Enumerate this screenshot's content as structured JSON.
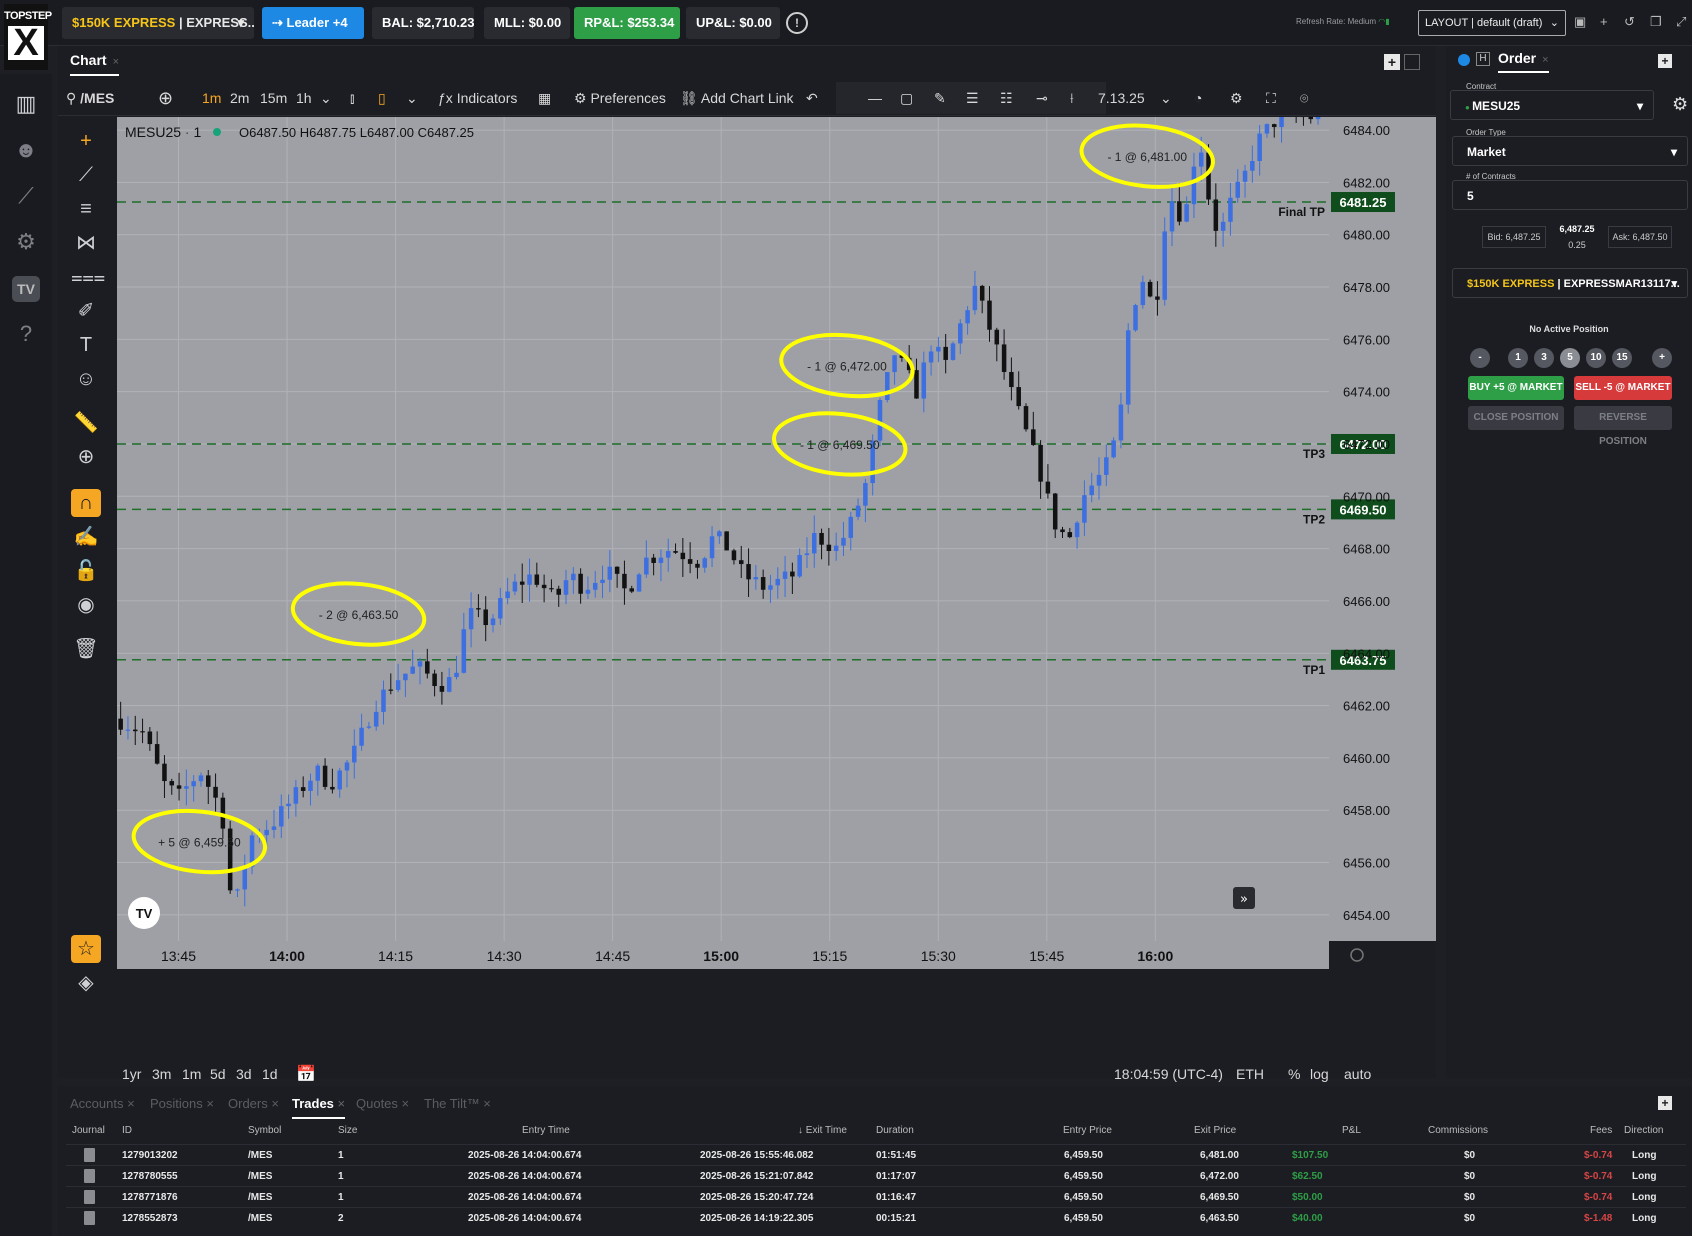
{
  "logo": {
    "line1": "TOPSTEP",
    "line2": "X"
  },
  "topbar": {
    "account_prefix": "$150K EXPRESS",
    "account_suffix": " | EXPRESS...",
    "leader_label": "Leader +4",
    "bal": "BAL: $2,710.23",
    "mll": "MLL: $0.00",
    "rpl": "RP&L: $253.34",
    "upl": "UP&L: $0.00",
    "refresh_label": "Refresh Rate: Medium",
    "layout_label": "LAYOUT | default (draft)"
  },
  "chart_panel": {
    "tab_label": "Chart",
    "symbol_search": "/MES",
    "timeframes": [
      "1m",
      "2m",
      "15m",
      "1h"
    ],
    "active_timeframe": "1m",
    "indicators_label": "Indicators",
    "preferences_label": "Preferences",
    "add_chart_link_label": "Add Chart Link",
    "version_label": "7.13.25",
    "bottom_ranges": [
      "1yr",
      "3m",
      "1m",
      "5d",
      "3d",
      "1d"
    ],
    "clock": "18:04:59 (UTC-4)",
    "session": "ETH",
    "scale_options": [
      "%",
      "log",
      "auto"
    ]
  },
  "chart_data": {
    "type": "candlestick",
    "symbol": "MESU25",
    "interval": "1",
    "ohlc_readout": {
      "open": "O6487.50",
      "high": "H6487.75",
      "low": "L6487.00",
      "close": "C6487.25"
    },
    "colors": {
      "up": "#3d6fe0",
      "down": "#121212",
      "background": "#9ea0a6",
      "tp_line": "#1f6e2a",
      "annotation": "#ffff00"
    },
    "ylim": [
      6453.0,
      6484.5
    ],
    "y_ticks": [
      "6484.00",
      "6482.00",
      "6480.00",
      "6478.00",
      "6476.00",
      "6474.00",
      "6472.00",
      "6470.00",
      "6468.00",
      "6466.00",
      "6464.00",
      "6462.00",
      "6460.00",
      "6458.00",
      "6456.00",
      "6454.00"
    ],
    "x_ticks": [
      {
        "label": "13:45",
        "minute": 0,
        "bold": false
      },
      {
        "label": "14:00",
        "minute": 15,
        "bold": true
      },
      {
        "label": "14:15",
        "minute": 30,
        "bold": false
      },
      {
        "label": "14:30",
        "minute": 45,
        "bold": false
      },
      {
        "label": "14:45",
        "minute": 60,
        "bold": false
      },
      {
        "label": "15:00",
        "minute": 75,
        "bold": true
      },
      {
        "label": "15:15",
        "minute": 90,
        "bold": false
      },
      {
        "label": "15:30",
        "minute": 105,
        "bold": false
      },
      {
        "label": "15:45",
        "minute": 120,
        "bold": false
      },
      {
        "label": "16:00",
        "minute": 135,
        "bold": true
      }
    ],
    "x_range_minutes": [
      -8.5,
      159
    ],
    "levels": [
      {
        "name": "Final TP",
        "price": 6481.25,
        "label": "6481.25"
      },
      {
        "name": "TP3",
        "price": 6472.0,
        "label": "6472.00"
      },
      {
        "name": "TP2",
        "price": 6469.5,
        "label": "6469.50"
      },
      {
        "name": "TP1",
        "price": 6463.75,
        "label": "6463.75"
      }
    ],
    "annotations": [
      {
        "text": "+ 5 @ 6,459.50",
        "minute": 1.5,
        "price": 6456.8
      },
      {
        "text": "- 2 @ 6,463.50",
        "minute": 23.5,
        "price": 6465.5
      },
      {
        "text": "- 1 @ 6,469.50",
        "minute": 90,
        "price": 6472.0
      },
      {
        "text": "- 1 @ 6,472.00",
        "minute": 91,
        "price": 6475.0
      },
      {
        "text": "- 1 @ 6,481.00",
        "minute": 132.5,
        "price": 6483.0
      }
    ],
    "anchors": [
      [
        -8.5,
        6461.5
      ],
      [
        -5,
        6461.0
      ],
      [
        -2,
        6459.0
      ],
      [
        0,
        6458.5
      ],
      [
        3,
        6459.5
      ],
      [
        6,
        6458.0
      ],
      [
        7,
        6455.0
      ],
      [
        8,
        6454.5
      ],
      [
        10,
        6457.0
      ],
      [
        13,
        6457.5
      ],
      [
        16,
        6458.5
      ],
      [
        19,
        6459.5
      ],
      [
        21,
        6459.0
      ],
      [
        24,
        6460.0
      ],
      [
        27,
        6462.0
      ],
      [
        30,
        6463.0
      ],
      [
        33,
        6463.5
      ],
      [
        36,
        6462.8
      ],
      [
        38,
        6463.0
      ],
      [
        40,
        6465.5
      ],
      [
        43,
        6465.2
      ],
      [
        46,
        6466.5
      ],
      [
        49,
        6467.0
      ],
      [
        52,
        6466.0
      ],
      [
        54,
        6467.0
      ],
      [
        56,
        6466.5
      ],
      [
        59,
        6467.2
      ],
      [
        62,
        6466.3
      ],
      [
        64,
        6467.5
      ],
      [
        68,
        6468.0
      ],
      [
        72,
        6467.5
      ],
      [
        74,
        6468.5
      ],
      [
        76,
        6468.0
      ],
      [
        78,
        6467.0
      ],
      [
        81,
        6466.5
      ],
      [
        85,
        6467.0
      ],
      [
        88,
        6468.5
      ],
      [
        91,
        6468.0
      ],
      [
        93,
        6469.0
      ],
      [
        95,
        6470.5
      ],
      [
        97,
        6473.5
      ],
      [
        99,
        6475.5
      ],
      [
        102,
        6474.0
      ],
      [
        104,
        6475.8
      ],
      [
        106,
        6475.0
      ],
      [
        108,
        6476.5
      ],
      [
        110,
        6478.0
      ],
      [
        112,
        6476.5
      ],
      [
        115,
        6474.0
      ],
      [
        117,
        6472.5
      ],
      [
        119,
        6471.0
      ],
      [
        121,
        6469.0
      ],
      [
        123,
        6468.3
      ],
      [
        125,
        6470.0
      ],
      [
        128,
        6471.0
      ],
      [
        130,
        6472.5
      ],
      [
        131,
        6476.0
      ],
      [
        133,
        6478.5
      ],
      [
        135,
        6477.0
      ],
      [
        136,
        6480.0
      ],
      [
        137,
        6481.5
      ],
      [
        139,
        6480.5
      ],
      [
        141,
        6484.0
      ],
      [
        142,
        6482.0
      ],
      [
        143,
        6480.5
      ],
      [
        144,
        6480.0
      ],
      [
        145,
        6481.0
      ],
      [
        147,
        6482.0
      ],
      [
        149,
        6483.5
      ],
      [
        151,
        6484.2
      ],
      [
        152,
        6484.5
      ]
    ]
  },
  "order_panel": {
    "tab_label": "Order",
    "contract_label": "Contract",
    "contract_value": "MESU25",
    "order_type_label": "Order Type",
    "order_type_value": "Market",
    "contracts_label": "# of Contracts",
    "contracts_value": "5",
    "bid": "Bid: 6,487.25",
    "last": "6,487.25",
    "spread": "0.25",
    "ask": "Ask: 6,487.50",
    "account_prefix": "$150K EXPRESS",
    "account_suffix": " | EXPRESSMAR13117...",
    "no_position": "No Active Position",
    "qty_buttons": [
      "-",
      "1",
      "3",
      "5",
      "10",
      "15",
      "+"
    ],
    "buy_label": "BUY +5 @ MARKET",
    "sell_label": "SELL -5 @ MARKET",
    "close_label": "CLOSE POSITION",
    "reverse_label": "REVERSE POSITION"
  },
  "trades_panel": {
    "tabs": [
      "Accounts",
      "Positions",
      "Orders",
      "Trades",
      "Quotes",
      "The Tilt™"
    ],
    "active_tab": "Trades",
    "columns": [
      "Journal",
      "ID",
      "Symbol",
      "Size",
      "Entry Time",
      "Exit Time",
      "Duration",
      "Entry Price",
      "Exit Price",
      "P&L",
      "Commissions",
      "Fees",
      "Direction"
    ],
    "rows": [
      {
        "id": "1279013202",
        "symbol": "/MES",
        "size": "1",
        "entry_time": "2025-08-26 14:04:00.674",
        "exit_time": "2025-08-26 15:55:46.082",
        "duration": "01:51:45",
        "entry_price": "6,459.50",
        "exit_price": "6,481.00",
        "pnl": "$107.50",
        "commissions": "$0",
        "fees": "$-0.74",
        "direction": "Long"
      },
      {
        "id": "1278780555",
        "symbol": "/MES",
        "size": "1",
        "entry_time": "2025-08-26 14:04:00.674",
        "exit_time": "2025-08-26 15:21:07.842",
        "duration": "01:17:07",
        "entry_price": "6,459.50",
        "exit_price": "6,472.00",
        "pnl": "$62.50",
        "commissions": "$0",
        "fees": "$-0.74",
        "direction": "Long"
      },
      {
        "id": "1278771876",
        "symbol": "/MES",
        "size": "1",
        "entry_time": "2025-08-26 14:04:00.674",
        "exit_time": "2025-08-26 15:20:47.724",
        "duration": "01:16:47",
        "entry_price": "6,459.50",
        "exit_price": "6,469.50",
        "pnl": "$50.00",
        "commissions": "$0",
        "fees": "$-0.74",
        "direction": "Long"
      },
      {
        "id": "1278552873",
        "symbol": "/MES",
        "size": "2",
        "entry_time": "2025-08-26 14:04:00.674",
        "exit_time": "2025-08-26 14:19:22.305",
        "duration": "00:15:21",
        "entry_price": "6,459.50",
        "exit_price": "6,463.50",
        "pnl": "$40.00",
        "commissions": "$0",
        "fees": "$-1.48",
        "direction": "Long"
      }
    ]
  }
}
